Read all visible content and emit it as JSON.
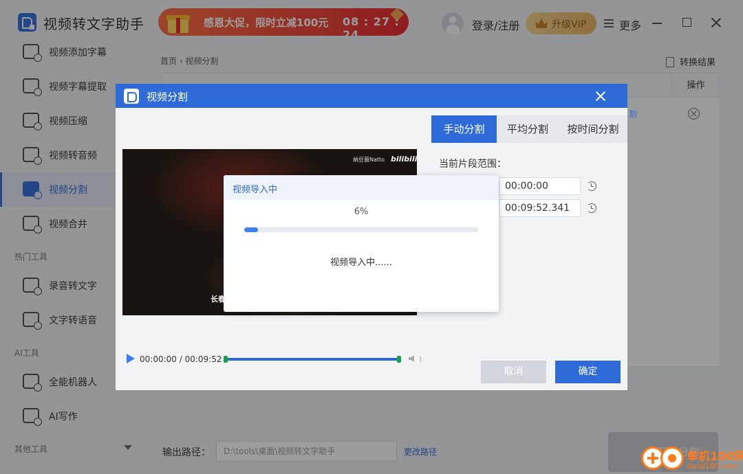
{
  "app": {
    "title": "视频转文字助手"
  },
  "promo": {
    "text": "感恩大促，限时立减100元",
    "countdown": "08 : 27 : 24"
  },
  "header": {
    "login": "登录/注册",
    "vip": "升级VIP",
    "more": "更多"
  },
  "sidebar": {
    "items": [
      {
        "label": "视频添加字幕"
      },
      {
        "label": "视频字幕提取"
      },
      {
        "label": "视频压缩"
      },
      {
        "label": "视频转音频"
      },
      {
        "label": "视频分割",
        "active": true
      },
      {
        "label": "视频合并"
      }
    ],
    "hot_section": "热门工具",
    "hot_items": [
      {
        "label": "录音转文字"
      },
      {
        "label": "文字转语音"
      }
    ],
    "ai_section": "AI工具",
    "ai_items": [
      {
        "label": "全能机器人"
      },
      {
        "label": "AI写作"
      }
    ],
    "other_section": "其他工具"
  },
  "main": {
    "breadcrumb": "首页 › 视频分割",
    "convert_result": "转换结果",
    "table_header_ops": "操作",
    "row_link_fragment": "割",
    "output_label": "输出路径：",
    "output_path": "D:\\tools\\桌面\\视频转文字助手",
    "change_path": "更改路径",
    "start_label": "开始分割"
  },
  "split_dialog": {
    "title": "视频分割",
    "tabs": [
      {
        "label": "手动分割",
        "active": true
      },
      {
        "label": "平均分割"
      },
      {
        "label": "按时间分割"
      }
    ],
    "segment_label": "当前片段范围：",
    "start_time": "00:00:00",
    "end_time": "00:09:52.341",
    "video_watermark": "纳豆菌Natto",
    "video_brand": "bilibili",
    "video_subtitle": "长春",
    "playback_time": "00:00:00  /  00:09:52",
    "cancel": "取消",
    "confirm": "确定"
  },
  "import_modal": {
    "title": "视频导入中",
    "percent": "6%",
    "progress": 0.06,
    "status": "视频导入中......"
  },
  "brand": {
    "name": "单机100网",
    "url": "danji100.com"
  },
  "colors": {
    "accent": "#2f6bd8",
    "promo": "#e8232a",
    "vip": "#e9b35b",
    "brand": "#ff7a1a"
  }
}
